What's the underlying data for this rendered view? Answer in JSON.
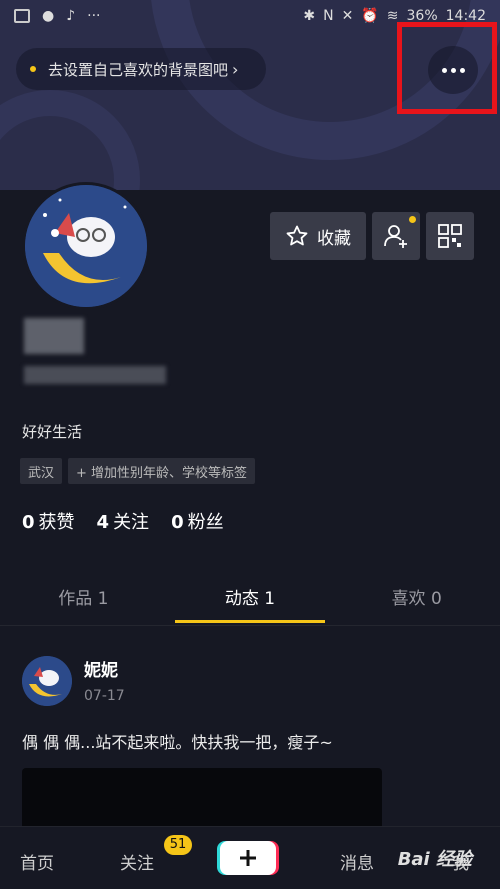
{
  "status_bar": {
    "battery": "36%",
    "time": "14:42"
  },
  "header": {
    "bg_hint": "去设置自己喜欢的背景图吧",
    "more_icon": "more-horizontal-icon"
  },
  "profile": {
    "favorite_label": "收藏",
    "bio": "好好生活",
    "tags": [
      "武汉",
      "+ 增加性别年龄、学校等标签"
    ],
    "stats": [
      {
        "value": "0",
        "label": "获赞"
      },
      {
        "value": "4",
        "label": "关注"
      },
      {
        "value": "0",
        "label": "粉丝"
      }
    ]
  },
  "tabs": [
    {
      "label": "作品 1",
      "active": false
    },
    {
      "label": "动态 1",
      "active": true
    },
    {
      "label": "喜欢 0",
      "active": false
    }
  ],
  "post": {
    "author": "妮妮",
    "date": "07-17",
    "text": "偶  偶  偶...站不起来啦。快扶我一把，瘦子~"
  },
  "bottom_nav": {
    "home": "首页",
    "follow": "关注",
    "follow_badge": "51",
    "messages": "消息",
    "me": "我",
    "watermark": "Bai 经验"
  },
  "colors": {
    "accent": "#f5c518",
    "highlight": "#e8141b",
    "background": "#161823"
  }
}
